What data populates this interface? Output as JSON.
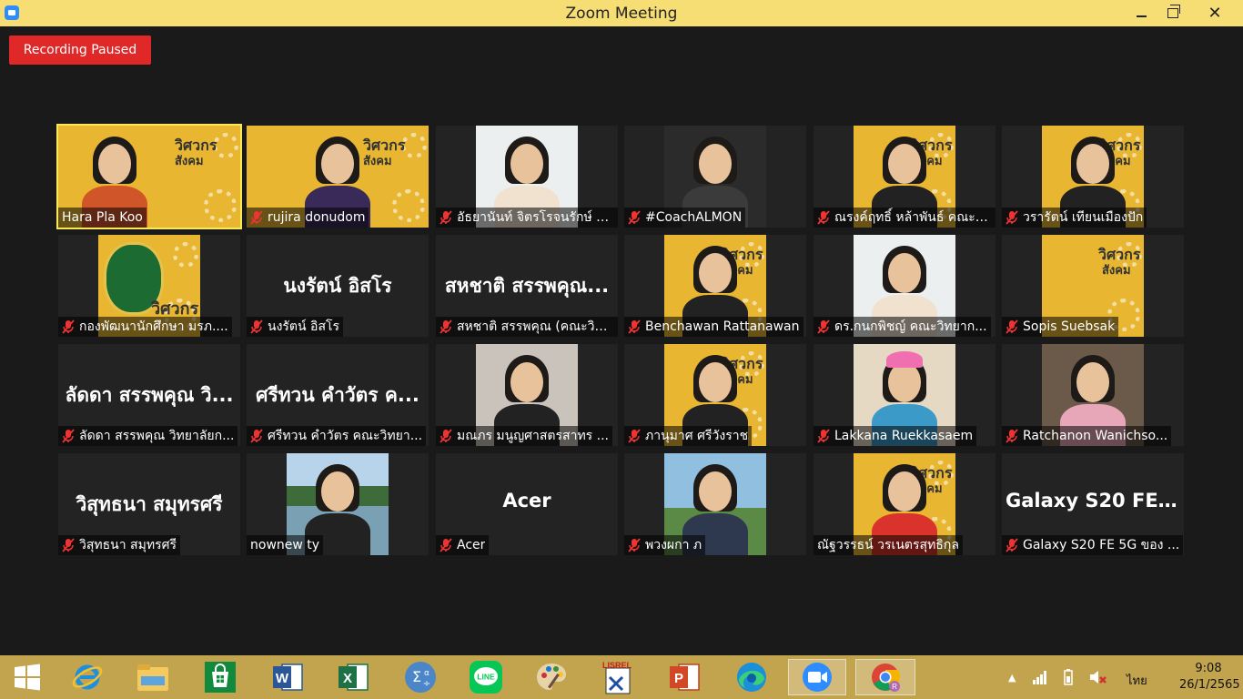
{
  "window": {
    "title": "Zoom Meeting"
  },
  "recording": {
    "label": "Recording Paused"
  },
  "participants": [
    {
      "name": "Hara Pla Koo",
      "muted": false
    },
    {
      "name": "rujira donudom",
      "muted": true
    },
    {
      "name": "อัธยานันท์ จิตรโรจนรักษ์ ค...",
      "muted": true
    },
    {
      "name": "#CoachALMON",
      "muted": true
    },
    {
      "name": "ณรงค์ฤทธิ์ หล้าพันธ์ คณะว...",
      "muted": true
    },
    {
      "name": "วรารัตน์ เทียนเมืองปัก",
      "muted": true
    },
    {
      "name": "กองพัฒนานักศึกษา มรภ....",
      "muted": true
    },
    {
      "name": "นงรัตน์ อิสโร",
      "muted": true,
      "big": "นงรัตน์ อิสโร"
    },
    {
      "name": "สหชาติ สรรพคุณ (คณะวิท...",
      "muted": true,
      "big": "สหชาติ สรรพคุณ..."
    },
    {
      "name": "Benchawan Rattanawan",
      "muted": true
    },
    {
      "name": "ดร.กนกพิชญ์ คณะวิทยาก...",
      "muted": true
    },
    {
      "name": "Sopis Suebsak",
      "muted": true
    },
    {
      "name": "ลัดดา สรรพคุณ วิทยาลัยก...",
      "muted": true,
      "big": "ลัดดา สรรพคุณ วิ..."
    },
    {
      "name": "ศรีทวน  คำวัตร คณะวิทยา...",
      "muted": true,
      "big": "ศรีทวน  คำวัตร ค..."
    },
    {
      "name": "มณภร มนูญศาสตรสาทร ...",
      "muted": true
    },
    {
      "name": "ภานุมาศ ศรีวังราช",
      "muted": true
    },
    {
      "name": "Lakkana Ruekkasaem",
      "muted": true
    },
    {
      "name": "Ratchanon Wanichso...",
      "muted": true
    },
    {
      "name": "วิสุทธนา สมุทรศรี",
      "muted": true,
      "big": "วิสุทธนา สมุทรศรี"
    },
    {
      "name": "nownew ty",
      "muted": false
    },
    {
      "name": "Acer",
      "muted": true,
      "big": "Acer"
    },
    {
      "name": "พวงผกา ภ",
      "muted": true
    },
    {
      "name": "ณัฐวรรธน์ วรเนตรสุทธิกุล",
      "muted": false
    },
    {
      "name": "Galaxy S20 FE 5G ของ ...",
      "muted": true,
      "big": "Galaxy S20 FE 5..."
    }
  ],
  "poster": {
    "line1": "วิศวกร",
    "line2": "สังคม"
  },
  "taskbar": {
    "apps": [
      "windows-start",
      "internet-explorer",
      "file-explorer",
      "store",
      "word",
      "excel",
      "math-input",
      "line",
      "paint",
      "lisrel",
      "powerpoint",
      "edge",
      "zoom",
      "chrome"
    ],
    "line_label": "LINE",
    "lisrel_label": "LISREL",
    "language": "ไทย",
    "time": "9:08",
    "date": "26/1/2565"
  },
  "colors": {
    "titlebar": "#f6dd74",
    "background": "#1a1a1a",
    "taskbar": "#c2a34e",
    "record": "#e02828",
    "active_speaker": "#f7ea56"
  }
}
